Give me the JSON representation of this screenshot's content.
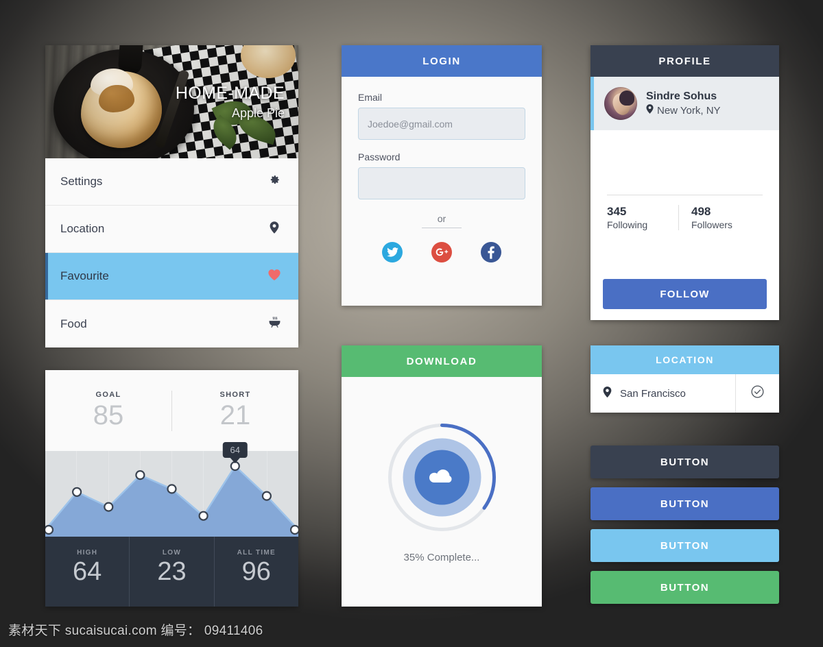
{
  "background": {
    "center_color": "#b6b0a4",
    "edge_color": "#232323"
  },
  "menu_card": {
    "hero": {
      "title": "HOME-MADE",
      "subtitle": "Apple Pie",
      "image_alt": "apple pie in a cast iron skillet"
    },
    "items": [
      {
        "label": "Settings",
        "icon": "gear-icon",
        "active": false
      },
      {
        "label": "Location",
        "icon": "pin-icon",
        "active": false
      },
      {
        "label": "Favourite",
        "icon": "heart-icon",
        "active": true
      },
      {
        "label": "Food",
        "icon": "hotpot-icon",
        "active": false
      }
    ],
    "active_bg": "#79c6ef",
    "heart_color": "#f06a6a"
  },
  "login_card": {
    "header": "LOGIN",
    "header_color": "#4a77c9",
    "email": {
      "label": "Email",
      "value": "",
      "placeholder": "Joedoe@gmail.com"
    },
    "password": {
      "label": "Password",
      "value": "",
      "placeholder": ""
    },
    "divider_text": "or",
    "socials": [
      {
        "name": "twitter-icon",
        "color": "#2ca8df"
      },
      {
        "name": "googleplus-icon",
        "color": "#dc4e41"
      },
      {
        "name": "facebook-icon",
        "color": "#3a5795"
      }
    ]
  },
  "profile_card": {
    "header": "PROFILE",
    "header_color": "#394150",
    "accent_color": "#79c6ef",
    "name": "Sindre Sohus",
    "location": "New York, NY",
    "stats": [
      {
        "value": "345",
        "label": "Following"
      },
      {
        "value": "498",
        "label": "Followers"
      }
    ],
    "follow_label": "FOLLOW",
    "follow_color": "#4a6fc4"
  },
  "stats_card": {
    "kpis": [
      {
        "label": "GOAL",
        "value": "85"
      },
      {
        "label": "SHORT",
        "value": "21"
      }
    ],
    "tooltip": "64",
    "footers": [
      {
        "label": "HIGH",
        "value": "64"
      },
      {
        "label": "LOW",
        "value": "23"
      },
      {
        "label": "ALL TIME",
        "value": "96"
      }
    ]
  },
  "chart_data": {
    "type": "area",
    "title": "",
    "xlabel": "",
    "ylabel": "",
    "x": [
      0,
      1,
      2,
      3,
      4,
      5,
      6,
      7,
      8
    ],
    "values": [
      0,
      38,
      23,
      55,
      41,
      14,
      64,
      34,
      0
    ],
    "highlight_index": 6,
    "highlight_value": 64,
    "ylim": [
      0,
      75
    ],
    "grid": true,
    "grid_columns": 8,
    "legend": "none",
    "area_color": "#7fa4d6",
    "line_color": "#9dc3ea",
    "plot_bg": "#dcdfe1",
    "marker": "circle-white"
  },
  "download_card": {
    "header": "DOWNLOAD",
    "header_color": "#57bb72",
    "progress_percent": 35,
    "status_text": "35% Complete...",
    "icon": "cloud-icon",
    "ring_track_color": "#e3e6ea",
    "ring_fill_color": "#4a6fc4"
  },
  "location_card": {
    "header": "LOCATION",
    "header_color": "#79c6ef",
    "city": "San Francisco",
    "pin_icon": "pin-icon",
    "confirm_icon": "check-circle-icon"
  },
  "buttons": [
    {
      "label": "BUTTON",
      "color": "#394150"
    },
    {
      "label": "BUTTON",
      "color": "#4a6fc4"
    },
    {
      "label": "BUTTON",
      "color": "#79c6ef"
    },
    {
      "label": "BUTTON",
      "color": "#57bb72"
    }
  ],
  "watermark": "素材天下 sucaisucai.com  编号： 09411406"
}
